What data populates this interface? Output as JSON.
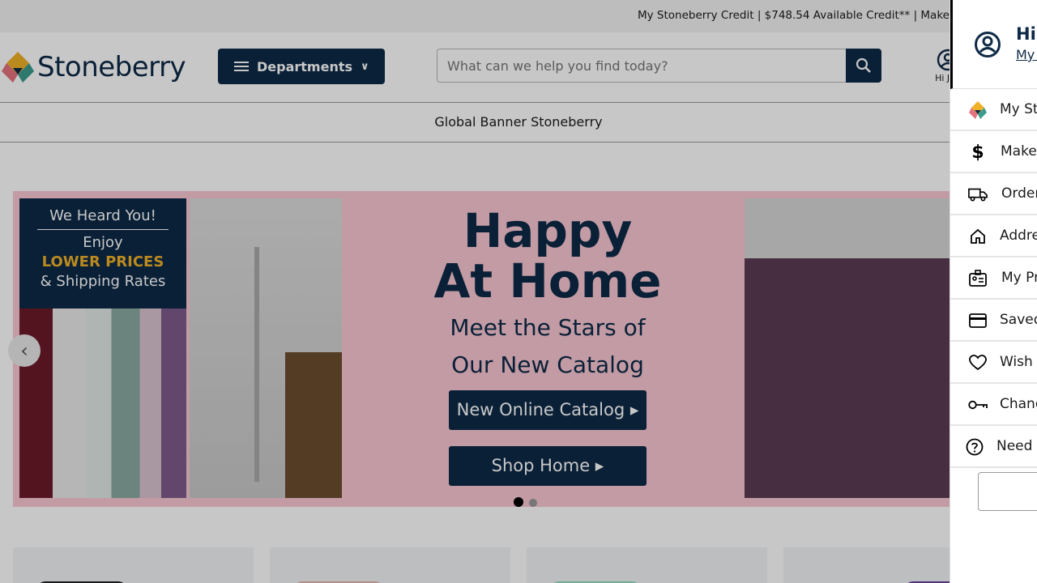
{
  "topbar": {
    "message": "My Stoneberry Credit | $748.54 Available Credit** | Make"
  },
  "header": {
    "logo_text": "Stoneberry",
    "departments_label": "Departments",
    "search_placeholder": "What can we help you find today?",
    "account_greeting": "Hi Joh"
  },
  "global_banner": {
    "text": "Global Banner Stoneberry"
  },
  "hero": {
    "left_panel_line1": "We Heard You!",
    "left_panel_line2": "Enjoy",
    "left_panel_line3": "LOWER PRICES",
    "left_panel_line4": "& Shipping Rates",
    "headline_line1": "Happy",
    "headline_line2": "At Home",
    "sub_line1": "Meet the Stars of",
    "sub_line2": "Our New Catalog",
    "cta_catalog": "New Online Catalog ▸",
    "cta_shop": "Shop Home ▸",
    "slide_count": 2,
    "active_slide": 1
  },
  "drawer": {
    "greeting": "Hi,",
    "account_link": "My A",
    "items": [
      {
        "label": "My Sto",
        "icon": "stoneberry-logo-icon"
      },
      {
        "label": "Make",
        "icon": "dollar-icon"
      },
      {
        "label": "Order",
        "icon": "truck-icon"
      },
      {
        "label": "Addre",
        "icon": "home-icon"
      },
      {
        "label": "My Pr",
        "icon": "profile-card-icon"
      },
      {
        "label": "Saved",
        "icon": "credit-card-icon"
      },
      {
        "label": "Wish L",
        "icon": "heart-icon"
      },
      {
        "label": "Chang",
        "icon": "key-icon"
      },
      {
        "label": "Need I",
        "icon": "help-circle-icon"
      }
    ]
  },
  "colors": {
    "brand_navy": "#0e2a47",
    "hero_pink": "#f9c7d2",
    "accent_gold": "#f0b128"
  }
}
